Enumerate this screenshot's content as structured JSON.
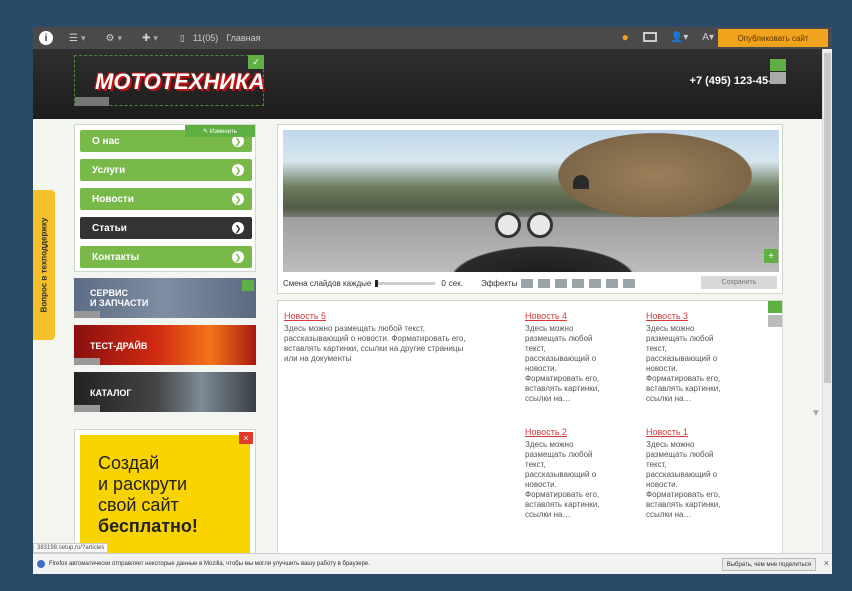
{
  "admin_bar": {
    "info_glyph": "i",
    "page_id": "11(05)",
    "page_name": "Главная",
    "publish_label": "Опубликовать сайт"
  },
  "header": {
    "logo": "МОТОТЕХНИКА",
    "phone": "+7 (495) 123-45-67"
  },
  "nav": {
    "edit_label": "✎ Изменить",
    "items": [
      {
        "label": "О нас"
      },
      {
        "label": "Услуги"
      },
      {
        "label": "Новости"
      },
      {
        "label": "Статьи",
        "active": true
      },
      {
        "label": "Контакты"
      }
    ]
  },
  "banners": {
    "service_line1": "СЕРВИС",
    "service_line2": "И ЗАПЧАСТИ",
    "test": "ТЕСТ-ДРАЙВ",
    "catalog": "КАТАЛОГ"
  },
  "ad": {
    "line1": "Создай",
    "line2": "и раскрути",
    "line3": "свой сайт",
    "line4": "бесплатно!",
    "close": "×"
  },
  "support_tab": "Вопрос в техподдержку",
  "slider": {
    "change_label": "Смена слайдов каждые",
    "seconds_value": "0",
    "seconds_unit": "сек.",
    "effects_label": "Эффекты",
    "save_label": "Сохранить",
    "edit_glyph": "+"
  },
  "news": [
    {
      "title": "Новость 5",
      "text": "Здесь можно размещать любой текст, рассказывающий о новости. Форматировать его, вставлять картинки, ссылки на другие страницы или на документы"
    },
    {
      "title": "Новость 4",
      "text": "Здесь можно размещать любой текст, рассказывающий о новости. Форматировать его, вставлять картинки, ссылки на…"
    },
    {
      "title": "Новость 3",
      "text": "Здесь можно размещать любой текст, рассказывающий о новости. Форматировать его, вставлять картинки, ссылки на…"
    },
    {
      "title": "Новость 2",
      "text": "Здесь можно размещать любой текст, рассказывающий о новости. Форматировать его, вставлять картинки, ссылки на…"
    },
    {
      "title": "Новость 1",
      "text": "Здесь можно размещать любой текст, рассказывающий о новости. Форматировать его, вставлять картинки, ссылки на…"
    }
  ],
  "status_url": "383198.setup.ru/?articles",
  "notification": {
    "text": "Firefox автоматически отправляет некоторые данные в Mozilla, чтобы мы могли улучшить вашу работу в браузере.",
    "button": "Выбрать, чем мне поделиться",
    "close": "×"
  },
  "colors": {
    "accent_green": "#79b94a",
    "publish_orange": "#f2a31d",
    "news_red": "#d03a3a",
    "ad_yellow": "#f8d300"
  }
}
